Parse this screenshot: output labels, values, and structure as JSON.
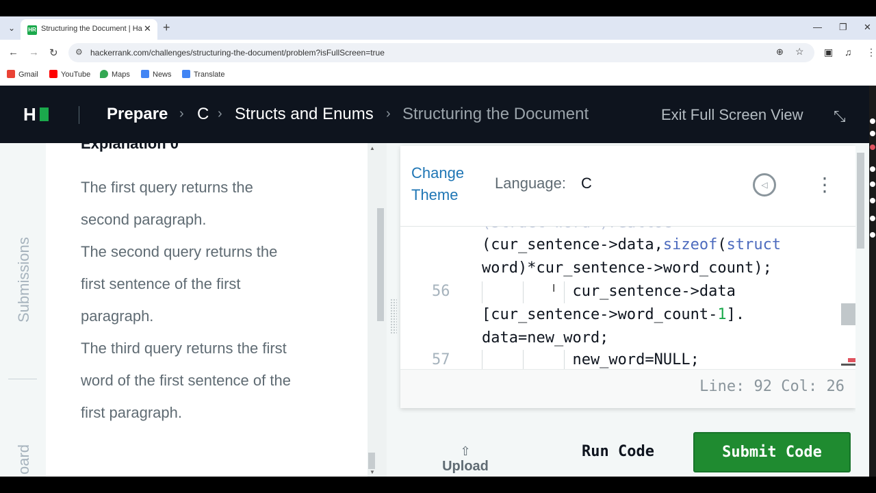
{
  "browser": {
    "tab_title": "Structuring the Document | Ha",
    "tab_favicon": "HR",
    "url": "hackerrank.com/challenges/structuring-the-document/problem?isFullScreen=true",
    "bookmarks": [
      {
        "label": "Gmail",
        "color": "#ea4335"
      },
      {
        "label": "YouTube",
        "color": "#ff0000"
      },
      {
        "label": "Maps",
        "color": "#34a853"
      },
      {
        "label": "News",
        "color": "#4285f4"
      },
      {
        "label": "Translate",
        "color": "#4285f4"
      }
    ]
  },
  "header": {
    "logo_letter": "H",
    "breadcrumbs": [
      "Prepare",
      "C",
      "Structs and Enums",
      "Structuring the Document"
    ],
    "exit_label": "Exit Full Screen View"
  },
  "sidebar": {
    "submissions_label": "Submissions",
    "leaderboard_label": "oard"
  },
  "problem": {
    "explanation_title": "Explanation 0",
    "lines": [
      "The first query returns the",
      "second paragraph.",
      "The second query returns the",
      "first sentence of the first",
      "paragraph.",
      "The third query returns the first",
      "word of the first sentence of the",
      "first paragraph."
    ]
  },
  "editor": {
    "change_theme_label": "Change Theme",
    "language_label": "Language:",
    "language_value": "C",
    "line_numbers": [
      "56",
      "57"
    ],
    "status": "Line: 92 Col: 26"
  },
  "actions": {
    "upload_label": "Upload",
    "run_label": "Run Code",
    "submit_label": "Submit Code"
  },
  "colors": {
    "brand_green": "#1ba94c",
    "header_bg": "#0e141e",
    "submit_bg": "#1f8b30",
    "link_blue": "#1f76b5"
  }
}
